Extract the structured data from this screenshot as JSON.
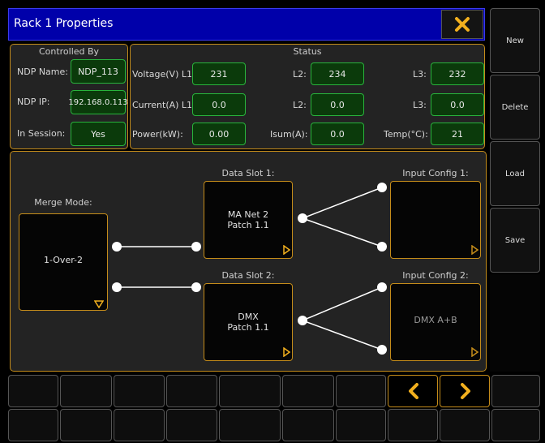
{
  "window": {
    "title": "Rack 1 Properties"
  },
  "side_buttons": {
    "new": "New",
    "delete": "Delete",
    "load": "Load",
    "save": "Save"
  },
  "controlled_by": {
    "title": "Controlled By",
    "ndp_name_label": "NDP Name:",
    "ndp_name": "NDP_113",
    "ndp_ip_label": "NDP IP:",
    "ndp_ip": "192.168.0.113",
    "in_session_label": "In Session:",
    "in_session": "Yes"
  },
  "status": {
    "title": "Status",
    "voltage_label": "Voltage(V) L1:",
    "voltage_l1": "231",
    "l2_label": "L2:",
    "voltage_l2": "234",
    "l3_label": "L3:",
    "voltage_l3": "232",
    "current_label": "Current(A) L1:",
    "current_l1": "0.0",
    "current_l2": "0.0",
    "current_l3": "0.0",
    "power_label": "Power(kW):",
    "power": "0.00",
    "isum_label": "Isum(A):",
    "isum": "0.0",
    "temp_label": "Temp(°C):",
    "temp": "21"
  },
  "merge": {
    "label": "Merge Mode:",
    "value": "1-Over-2"
  },
  "data_slot_1": {
    "label": "Data Slot 1:",
    "line1": "MA Net 2",
    "line2": "Patch 1.1"
  },
  "data_slot_2": {
    "label": "Data Slot 2:",
    "line1": "DMX",
    "line2": "Patch 1.1"
  },
  "input_config_1": {
    "label": "Input Config 1:",
    "value": ""
  },
  "input_config_2": {
    "label": "Input Config 2:",
    "value": "DMX A+B"
  },
  "colors": {
    "accent": "#c48c1a",
    "title_bar": "#0000aa",
    "value_green": "#28b43c",
    "icon_yellow": "#f2b01e"
  }
}
